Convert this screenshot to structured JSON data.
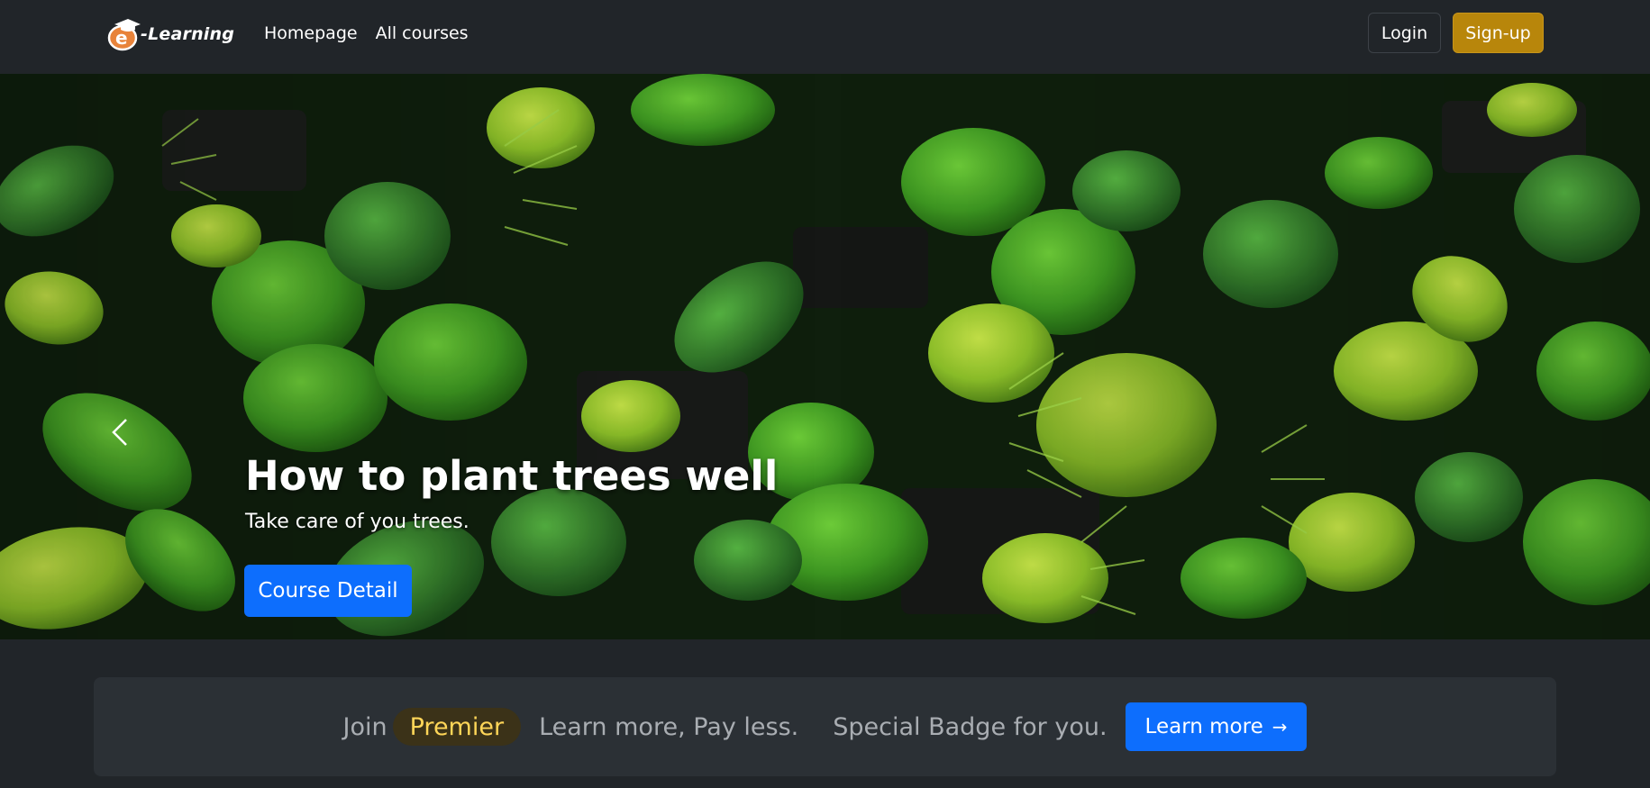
{
  "navbar": {
    "brand_text": "-Learning",
    "links": [
      "Homepage",
      "All courses"
    ],
    "login_label": "Login",
    "signup_label": "Sign-up"
  },
  "hero": {
    "title": "How to plant trees well",
    "subtitle": "Take care of you trees.",
    "cta_label": "Course Detail",
    "slide_count": 2,
    "active_slide": 2
  },
  "banner": {
    "join_text": "Join",
    "badge_text": "Premier",
    "tagline_1": "Learn more, Pay less.",
    "tagline_2": "Special Badge for you.",
    "cta_label": "Learn more",
    "cta_arrow": "→"
  },
  "colors": {
    "background": "#212529",
    "primary": "#0d6efd",
    "signup": "#b8860b",
    "badge_text": "#ffd658"
  },
  "icons": {
    "logo": "e-learning-logo-icon",
    "prev": "chevron-left-icon",
    "arrow": "arrow-right-icon"
  }
}
